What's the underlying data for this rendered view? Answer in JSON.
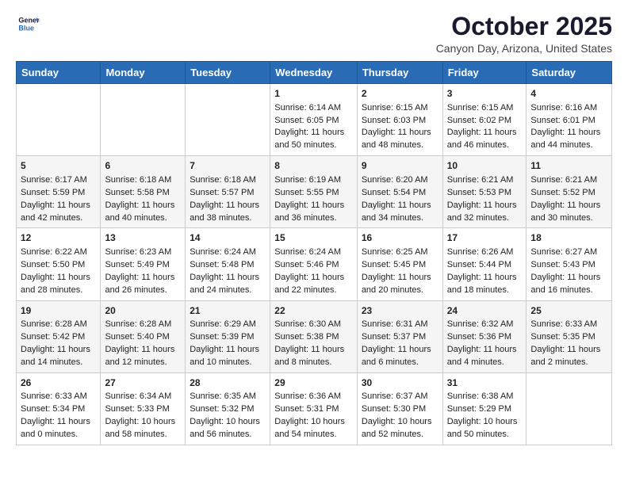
{
  "header": {
    "logo_line1": "General",
    "logo_line2": "Blue",
    "month": "October 2025",
    "location": "Canyon Day, Arizona, United States"
  },
  "days_of_week": [
    "Sunday",
    "Monday",
    "Tuesday",
    "Wednesday",
    "Thursday",
    "Friday",
    "Saturday"
  ],
  "weeks": [
    [
      {
        "day": "",
        "info": ""
      },
      {
        "day": "",
        "info": ""
      },
      {
        "day": "",
        "info": ""
      },
      {
        "day": "1",
        "info": "Sunrise: 6:14 AM\nSunset: 6:05 PM\nDaylight: 11 hours\nand 50 minutes."
      },
      {
        "day": "2",
        "info": "Sunrise: 6:15 AM\nSunset: 6:03 PM\nDaylight: 11 hours\nand 48 minutes."
      },
      {
        "day": "3",
        "info": "Sunrise: 6:15 AM\nSunset: 6:02 PM\nDaylight: 11 hours\nand 46 minutes."
      },
      {
        "day": "4",
        "info": "Sunrise: 6:16 AM\nSunset: 6:01 PM\nDaylight: 11 hours\nand 44 minutes."
      }
    ],
    [
      {
        "day": "5",
        "info": "Sunrise: 6:17 AM\nSunset: 5:59 PM\nDaylight: 11 hours\nand 42 minutes."
      },
      {
        "day": "6",
        "info": "Sunrise: 6:18 AM\nSunset: 5:58 PM\nDaylight: 11 hours\nand 40 minutes."
      },
      {
        "day": "7",
        "info": "Sunrise: 6:18 AM\nSunset: 5:57 PM\nDaylight: 11 hours\nand 38 minutes."
      },
      {
        "day": "8",
        "info": "Sunrise: 6:19 AM\nSunset: 5:55 PM\nDaylight: 11 hours\nand 36 minutes."
      },
      {
        "day": "9",
        "info": "Sunrise: 6:20 AM\nSunset: 5:54 PM\nDaylight: 11 hours\nand 34 minutes."
      },
      {
        "day": "10",
        "info": "Sunrise: 6:21 AM\nSunset: 5:53 PM\nDaylight: 11 hours\nand 32 minutes."
      },
      {
        "day": "11",
        "info": "Sunrise: 6:21 AM\nSunset: 5:52 PM\nDaylight: 11 hours\nand 30 minutes."
      }
    ],
    [
      {
        "day": "12",
        "info": "Sunrise: 6:22 AM\nSunset: 5:50 PM\nDaylight: 11 hours\nand 28 minutes."
      },
      {
        "day": "13",
        "info": "Sunrise: 6:23 AM\nSunset: 5:49 PM\nDaylight: 11 hours\nand 26 minutes."
      },
      {
        "day": "14",
        "info": "Sunrise: 6:24 AM\nSunset: 5:48 PM\nDaylight: 11 hours\nand 24 minutes."
      },
      {
        "day": "15",
        "info": "Sunrise: 6:24 AM\nSunset: 5:46 PM\nDaylight: 11 hours\nand 22 minutes."
      },
      {
        "day": "16",
        "info": "Sunrise: 6:25 AM\nSunset: 5:45 PM\nDaylight: 11 hours\nand 20 minutes."
      },
      {
        "day": "17",
        "info": "Sunrise: 6:26 AM\nSunset: 5:44 PM\nDaylight: 11 hours\nand 18 minutes."
      },
      {
        "day": "18",
        "info": "Sunrise: 6:27 AM\nSunset: 5:43 PM\nDaylight: 11 hours\nand 16 minutes."
      }
    ],
    [
      {
        "day": "19",
        "info": "Sunrise: 6:28 AM\nSunset: 5:42 PM\nDaylight: 11 hours\nand 14 minutes."
      },
      {
        "day": "20",
        "info": "Sunrise: 6:28 AM\nSunset: 5:40 PM\nDaylight: 11 hours\nand 12 minutes."
      },
      {
        "day": "21",
        "info": "Sunrise: 6:29 AM\nSunset: 5:39 PM\nDaylight: 11 hours\nand 10 minutes."
      },
      {
        "day": "22",
        "info": "Sunrise: 6:30 AM\nSunset: 5:38 PM\nDaylight: 11 hours\nand 8 minutes."
      },
      {
        "day": "23",
        "info": "Sunrise: 6:31 AM\nSunset: 5:37 PM\nDaylight: 11 hours\nand 6 minutes."
      },
      {
        "day": "24",
        "info": "Sunrise: 6:32 AM\nSunset: 5:36 PM\nDaylight: 11 hours\nand 4 minutes."
      },
      {
        "day": "25",
        "info": "Sunrise: 6:33 AM\nSunset: 5:35 PM\nDaylight: 11 hours\nand 2 minutes."
      }
    ],
    [
      {
        "day": "26",
        "info": "Sunrise: 6:33 AM\nSunset: 5:34 PM\nDaylight: 11 hours\nand 0 minutes."
      },
      {
        "day": "27",
        "info": "Sunrise: 6:34 AM\nSunset: 5:33 PM\nDaylight: 10 hours\nand 58 minutes."
      },
      {
        "day": "28",
        "info": "Sunrise: 6:35 AM\nSunset: 5:32 PM\nDaylight: 10 hours\nand 56 minutes."
      },
      {
        "day": "29",
        "info": "Sunrise: 6:36 AM\nSunset: 5:31 PM\nDaylight: 10 hours\nand 54 minutes."
      },
      {
        "day": "30",
        "info": "Sunrise: 6:37 AM\nSunset: 5:30 PM\nDaylight: 10 hours\nand 52 minutes."
      },
      {
        "day": "31",
        "info": "Sunrise: 6:38 AM\nSunset: 5:29 PM\nDaylight: 10 hours\nand 50 minutes."
      },
      {
        "day": "",
        "info": ""
      }
    ]
  ]
}
